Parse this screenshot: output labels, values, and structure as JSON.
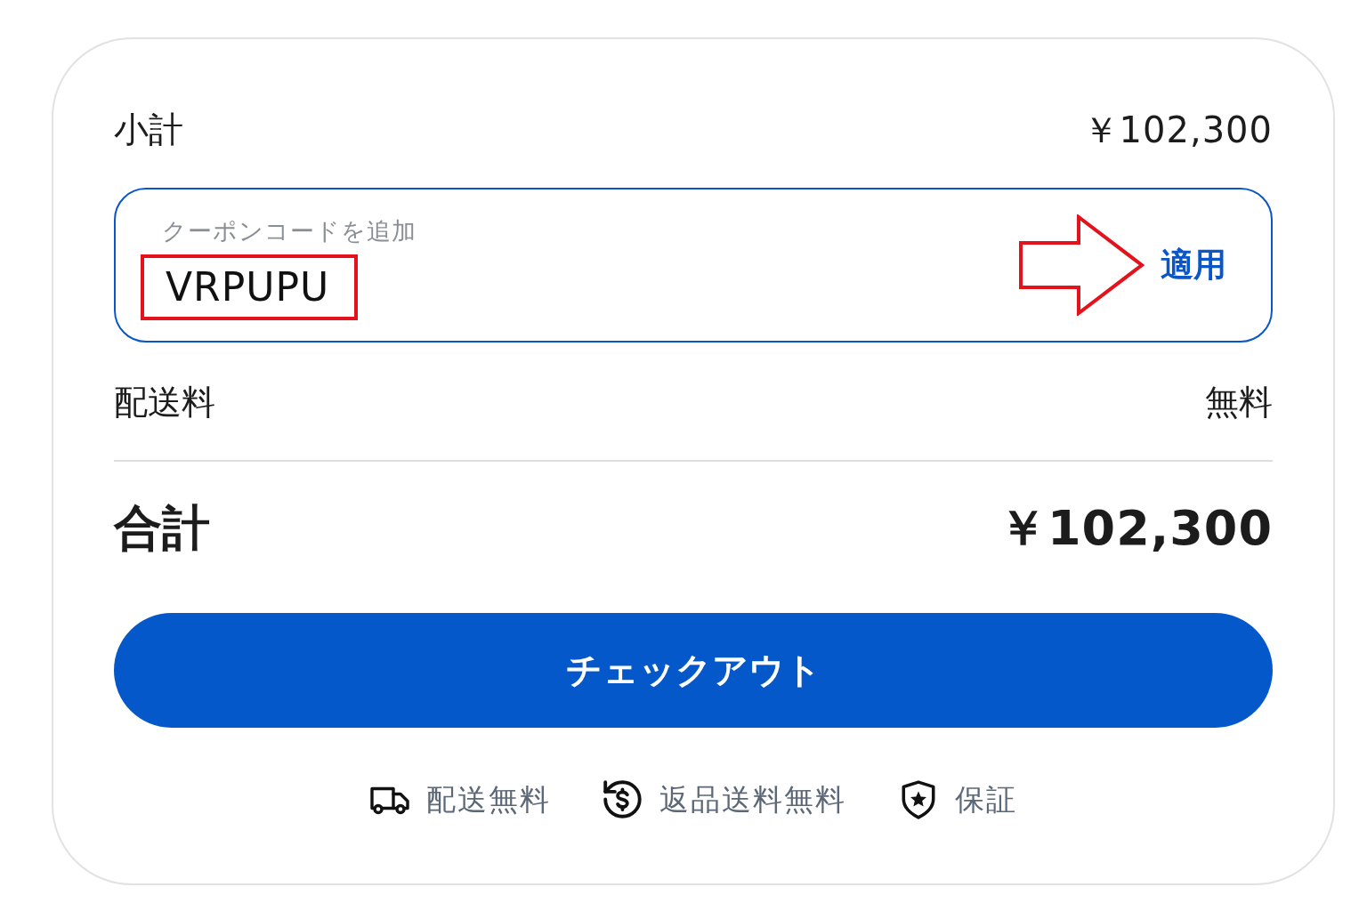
{
  "subtotal": {
    "label": "小計",
    "amount": "￥102,300"
  },
  "coupon": {
    "label": "クーポンコードを追加",
    "value": "VRPUPU",
    "value_highlighted": true,
    "apply_label": "適用",
    "apply_arrow": true
  },
  "shipping": {
    "label": "配送料",
    "amount": "無料"
  },
  "total": {
    "label": "合計",
    "amount": "￥102,300"
  },
  "checkout_button": "チェックアウト",
  "features": [
    {
      "kind": "shipping",
      "label": "配送無料"
    },
    {
      "kind": "returns",
      "label": "返品送料無料"
    },
    {
      "kind": "warranty",
      "label": "保証"
    }
  ]
}
